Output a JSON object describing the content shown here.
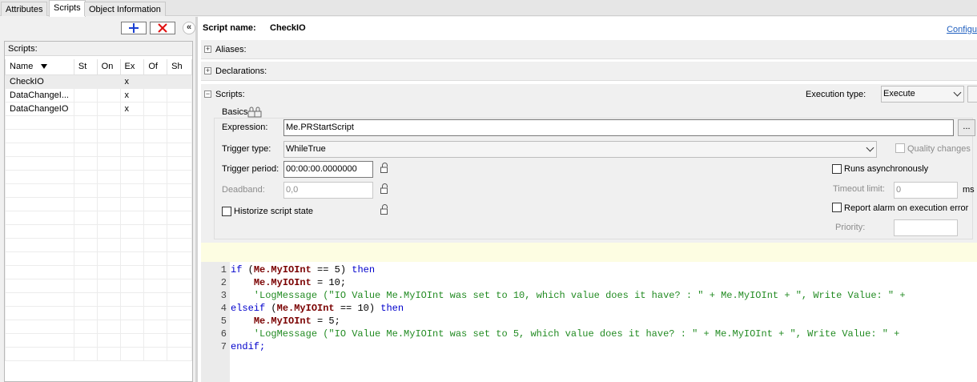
{
  "tabs": [
    "Attributes",
    "Scripts",
    "Object Information"
  ],
  "active_tab": "Scripts",
  "left": {
    "caption": "Scripts:",
    "columns": [
      "Name",
      "St",
      "On",
      "Ex",
      "Of",
      "Sh"
    ],
    "rows": [
      {
        "name": "CheckIO",
        "ex": "x"
      },
      {
        "name": "DataChangeI...",
        "ex": "x"
      },
      {
        "name": "DataChangeIO",
        "ex": "x"
      }
    ]
  },
  "header": {
    "script_name_label": "Script name:",
    "script_name": "CheckIO",
    "configure": "Configu"
  },
  "sections": {
    "aliases": "Aliases:",
    "declarations": "Declarations:",
    "scripts": "Scripts:"
  },
  "execution": {
    "label": "Execution type:",
    "value": "Execute"
  },
  "basics": {
    "title": "Basics",
    "expression_label": "Expression:",
    "expression": "Me.PRStartScript",
    "ellipsis": "...",
    "trigger_type_label": "Trigger type:",
    "trigger_type": "WhileTrue",
    "quality_changes": "Quality changes",
    "trigger_period_label": "Trigger period:",
    "trigger_period": "00:00:00.0000000",
    "deadband_label": "Deadband:",
    "deadband": "0,0",
    "historize": "Historize script state",
    "runs_async": "Runs asynchronously",
    "timeout_label": "Timeout limit:",
    "timeout": "0",
    "timeout_unit": "ms",
    "report_alarm": "Report alarm on execution error",
    "priority_label": "Priority:",
    "priority": ""
  },
  "code": {
    "line_numbers": [
      "1",
      "2",
      "3",
      "4",
      "5",
      "6",
      "7"
    ],
    "l1_if": "if",
    "l1_a": " (",
    "l1_me": "Me.MyIOInt",
    "l1_b": " == 5) ",
    "l1_then": "then",
    "l2_ind": "    ",
    "l2_me": "Me.MyIOInt",
    "l2_rest": " = 10;",
    "l3": "    'LogMessage (\"IO Value Me.MyIOInt was set to 10, which value does it have? : \" + Me.MyIOInt + \", Write Value: \" +",
    "l4_elseif": "elseif",
    "l4_a": " (",
    "l4_me": "Me.MyIOInt",
    "l4_b": " == 10) ",
    "l4_then": "then",
    "l5_ind": "    ",
    "l5_me": "Me.MyIOInt",
    "l5_rest": " = 5;",
    "l6": "    'LogMessage (\"IO Value Me.MyIOInt was set to 5, which value does it have? : \" + Me.MyIOInt + \", Write Value: \" +",
    "l7": "endif;"
  },
  "colors": {
    "keyword": "#0000cc",
    "member": "#7a0000",
    "comment": "#228b22",
    "add_icon": "#1a3fd1",
    "delete_icon": "#e01010",
    "link": "#1f5fbf"
  },
  "icons": {
    "add": "plus-icon",
    "delete": "x-icon",
    "collapse": "double-chevron-left-icon",
    "lock": "padlock-icon"
  }
}
